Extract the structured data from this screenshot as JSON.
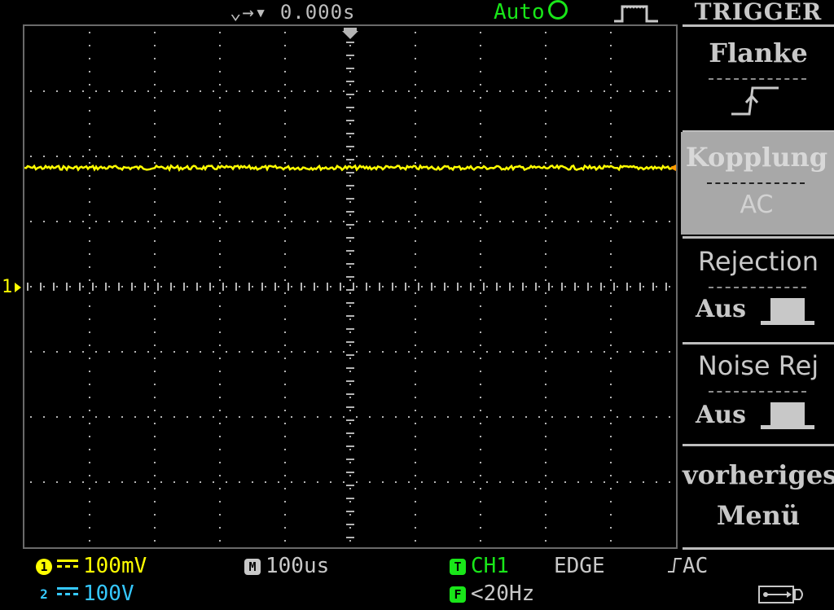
{
  "top": {
    "timebase_pos": "0.000s",
    "mode": "Auto"
  },
  "screen": {
    "channel_marker": "1"
  },
  "menu": {
    "title": "TRIGGER",
    "items": [
      {
        "label": "Flanke",
        "value": ""
      },
      {
        "label": "Kopplung",
        "value": "AC"
      },
      {
        "label": "Rejection",
        "value": "Aus"
      },
      {
        "label": "Noise Rej",
        "value": "Aus"
      },
      {
        "label": "vorheriges",
        "value": "Menü"
      }
    ]
  },
  "bottom": {
    "ch1_badge": "1",
    "ch1_scale": "100mV",
    "ch2_badge": "2",
    "ch2_scale": "100V",
    "m_badge": "M",
    "time_scale": "100us",
    "t_badge": "T",
    "trig_source": "CH1",
    "trig_type": "EDGE",
    "trig_coupling": "AC",
    "f_badge": "F",
    "freq": "<20Hz"
  },
  "colors": {
    "ch1": "#ffff00",
    "ch2": "#35c8ff",
    "trigger": "#19e619",
    "grid": "#b4b4b4",
    "menu_selected": "#a8a8a8"
  }
}
